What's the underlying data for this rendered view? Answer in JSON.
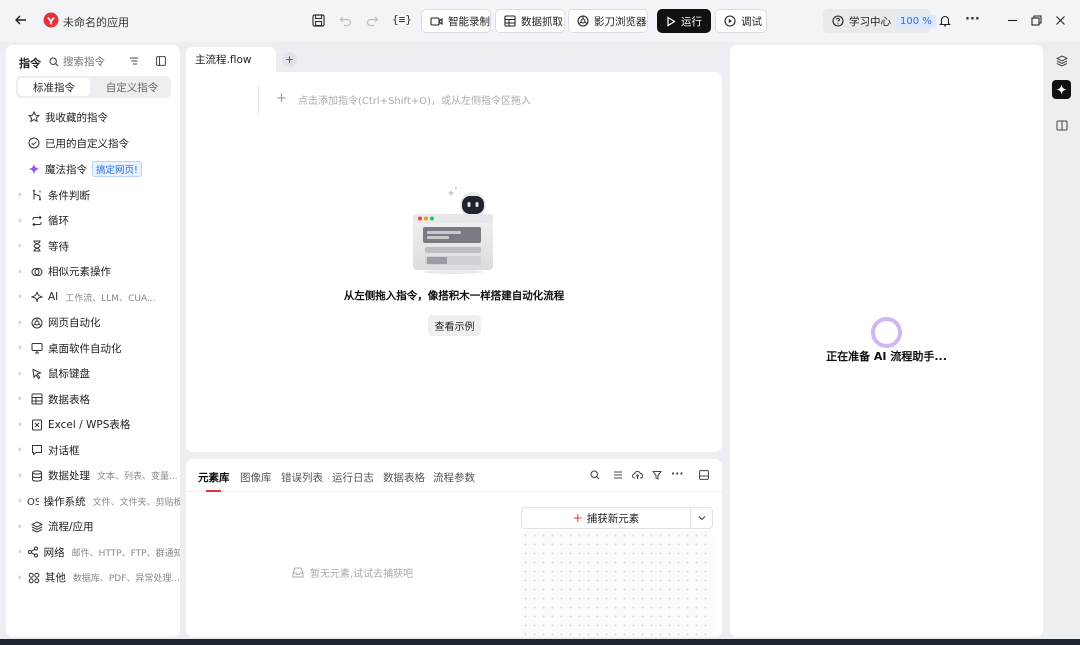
{
  "app": {
    "title": "未命名的应用",
    "save_icon": "save-icon",
    "undo_icon": "undo-icon",
    "redo_icon": "redo-icon",
    "variables_icon": "variables-icon"
  },
  "toolbar": {
    "record_label": "智能录制",
    "capture_label": "数据抓取",
    "browser_label": "影刀浏览器",
    "run_label": "运行",
    "debug_label": "调试",
    "learn_label": "学习中心",
    "zoom": "100 %"
  },
  "sidebar": {
    "title": "指令",
    "search_placeholder": "搜索指令",
    "tabs": [
      "标准指令",
      "自定义指令"
    ],
    "top_items": [
      {
        "label": "我收藏的指令",
        "icon": "star-icon"
      },
      {
        "label": "已用的自定义指令",
        "icon": "check-circle-icon"
      },
      {
        "label": "魔法指令",
        "icon": "sparkle-icon",
        "badge": "搞定网页!"
      }
    ],
    "items": [
      {
        "label": "条件判断",
        "icon": "branch-icon",
        "sub": ""
      },
      {
        "label": "循环",
        "icon": "loop-icon",
        "sub": ""
      },
      {
        "label": "等待",
        "icon": "hourglass-icon",
        "sub": ""
      },
      {
        "label": "相似元素操作",
        "icon": "similar-icon",
        "sub": ""
      },
      {
        "label": "AI",
        "icon": "ai-icon",
        "sub": "工作流、LLM、CUA..."
      },
      {
        "label": "网页自动化",
        "icon": "browser-icon",
        "sub": ""
      },
      {
        "label": "桌面软件自动化",
        "icon": "desktop-icon",
        "sub": ""
      },
      {
        "label": "鼠标键盘",
        "icon": "cursor-icon",
        "sub": ""
      },
      {
        "label": "数据表格",
        "icon": "table-icon",
        "sub": ""
      },
      {
        "label": "Excel / WPS表格",
        "icon": "excel-icon",
        "sub": ""
      },
      {
        "label": "对话框",
        "icon": "dialog-icon",
        "sub": ""
      },
      {
        "label": "数据处理",
        "icon": "database-icon",
        "sub": "文本、列表、变量..."
      },
      {
        "label": "操作系统",
        "icon": "os-icon",
        "sub": "文件、文件夹、剪贴板"
      },
      {
        "label": "流程/应用",
        "icon": "layers-icon",
        "sub": ""
      },
      {
        "label": "网络",
        "icon": "share-icon",
        "sub": "邮件、HTTP、FTP、群通知"
      },
      {
        "label": "其他",
        "icon": "grid-icon",
        "sub": "数据库、PDF、异常处理..."
      }
    ]
  },
  "editor": {
    "file_tab": "主流程.flow",
    "add_hint": "点击添加指令(Ctrl+Shift+O)，或从左侧指令区拖入",
    "empty_title": "从左侧拖入指令，像搭积木一样搭建自动化流程",
    "example_button": "查看示例"
  },
  "bottom": {
    "tabs": [
      "元素库",
      "图像库",
      "错误列表",
      "运行日志",
      "数据表格",
      "流程参数"
    ],
    "active_tab": 0,
    "empty_text": "暂无元素,试试去捕获吧",
    "capture_button": "捕获新元素"
  },
  "assistant": {
    "loading_text": "正在准备 AI 流程助手..."
  },
  "colors": {
    "accent_red": "#e8323a",
    "badge_bg": "#e8f1ff",
    "badge_text": "#2a6fe0",
    "spinner": "#cdb8f5",
    "sparkle": "#8b5cf6"
  }
}
